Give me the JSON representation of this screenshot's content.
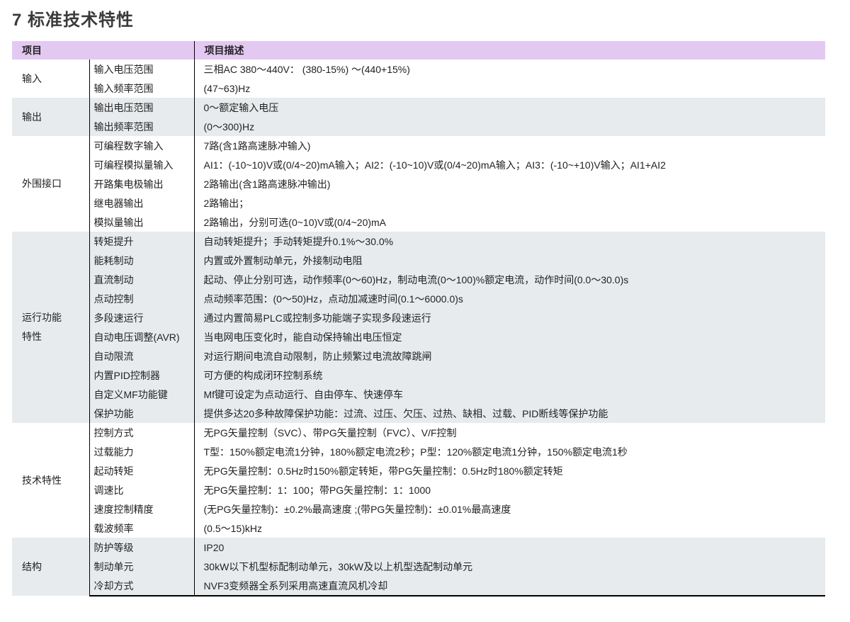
{
  "page_title": "7 标准技术特性",
  "header": {
    "col1": "项目",
    "col2": "项目描述"
  },
  "groups": [
    {
      "category": "输入",
      "shaded": false,
      "rows": [
        {
          "item": "输入电压范围",
          "desc": "三相AC 380～440V： (380-15%) ～(440+15%)"
        },
        {
          "item": "输入频率范围",
          "desc": "(47~63)Hz"
        }
      ]
    },
    {
      "category": "输出",
      "shaded": true,
      "rows": [
        {
          "item": "输出电压范围",
          "desc": "0～额定输入电压"
        },
        {
          "item": "输出频率范围",
          "desc": "(0～300)Hz"
        }
      ]
    },
    {
      "category": "外围接口",
      "shaded": false,
      "rows": [
        {
          "item": "可编程数字输入",
          "desc": "7路(含1路高速脉冲输入)"
        },
        {
          "item": "可编程模拟量输入",
          "desc": "AI1：(-10~10)V或(0/4~20)mA输入；AI2：(-10~10)V或(0/4~20)mA输入；AI3：(-10~+10)V输入；AI1+AI2"
        },
        {
          "item": "开路集电极输出",
          "desc": "2路输出(含1路高速脉冲输出)"
        },
        {
          "item": "继电器输出",
          "desc": "2路输出；"
        },
        {
          "item": "模拟量输出",
          "desc": "2路输出，分别可选(0~10)V或(0/4~20)mA"
        }
      ]
    },
    {
      "category": "运行功能\n特性",
      "shaded": true,
      "rows": [
        {
          "item": "转矩提升",
          "desc": "自动转矩提升；手动转矩提升0.1%～30.0%"
        },
        {
          "item": "能耗制动",
          "desc": "内置或外置制动单元，外接制动电阻"
        },
        {
          "item": "直流制动",
          "desc": "起动、停止分别可选，动作频率(0～60)Hz，制动电流(0～100)%额定电流，动作时间(0.0～30.0)s"
        },
        {
          "item": "点动控制",
          "desc": "点动频率范围：(0～50)Hz，点动加减速时间(0.1～6000.0)s"
        },
        {
          "item": "多段速运行",
          "desc": "通过内置简易PLC或控制多功能端子实现多段速运行"
        },
        {
          "item": "自动电压调整(AVR)",
          "desc": "当电网电压变化时，能自动保持输出电压恒定"
        },
        {
          "item": "自动限流",
          "desc": "对运行期间电流自动限制，防止频繁过电流故障跳闸"
        },
        {
          "item": "内置PID控制器",
          "desc": "可方便的构成闭环控制系统"
        },
        {
          "item": "自定义MF功能键",
          "desc": "Mf键可设定为点动运行、自由停车、快速停车"
        },
        {
          "item": "保护功能",
          "desc": "提供多达20多种故障保护功能：过流、过压、欠压、过热、缺相、过载、PID断线等保护功能"
        }
      ]
    },
    {
      "category": "技术特性",
      "shaded": false,
      "rows": [
        {
          "item": "控制方式",
          "desc": "无PG矢量控制（SVC）、带PG矢量控制（FVC）、V/F控制"
        },
        {
          "item": "过载能力",
          "desc": "T型：150%额定电流1分钟，180%额定电流2秒；P型：120%额定电流1分钟，150%额定电流1秒"
        },
        {
          "item": "起动转矩",
          "desc": "无PG矢量控制：0.5Hz时150%额定转矩，带PG矢量控制：0.5Hz时180%额定转矩"
        },
        {
          "item": "调速比",
          "desc": "无PG矢量控制：1：100；带PG矢量控制：1：1000"
        },
        {
          "item": "速度控制精度",
          "desc": "(无PG矢量控制)：±0.2%最高速度 ;(带PG矢量控制)：±0.01%最高速度"
        },
        {
          "item": "载波频率",
          "desc": "(0.5～15)kHz"
        }
      ]
    },
    {
      "category": "结构",
      "shaded": true,
      "rows": [
        {
          "item": "防护等级",
          "desc": "IP20"
        },
        {
          "item": "制动单元",
          "desc": "30kW以下机型标配制动单元，30kW及以上机型选配制动单元"
        },
        {
          "item": "冷却方式",
          "desc": "NVF3变频器全系列采用高速直流风机冷却"
        }
      ]
    }
  ]
}
